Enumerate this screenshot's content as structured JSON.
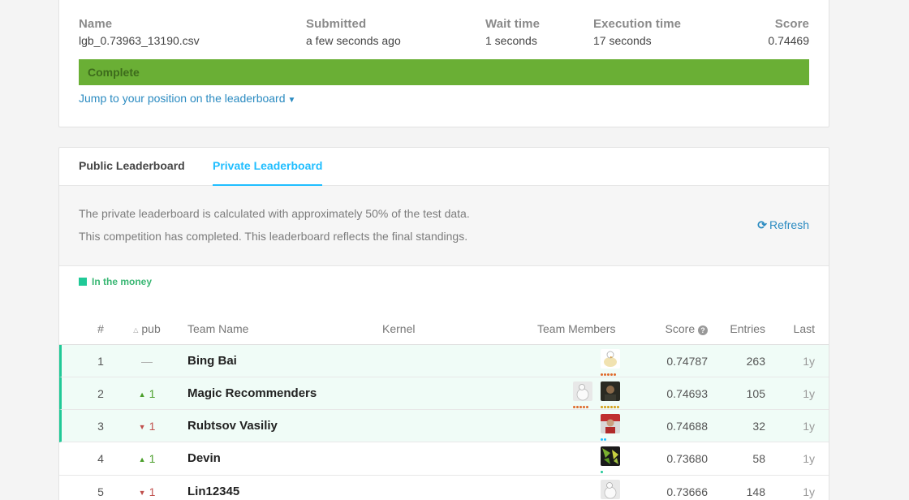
{
  "submission": {
    "name_label": "Name",
    "name_value": "lgb_0.73963_13190.csv",
    "submitted_label": "Submitted",
    "submitted_value": "a few seconds ago",
    "wait_label": "Wait time",
    "wait_value": "1 seconds",
    "exec_label": "Execution time",
    "exec_value": "17 seconds",
    "score_label": "Score",
    "score_value": "0.74469",
    "status": "Complete",
    "jump_link": "Jump to your position on the leaderboard"
  },
  "leaderboard": {
    "tabs": [
      {
        "label": "Public Leaderboard"
      },
      {
        "label": "Private Leaderboard"
      }
    ],
    "info_line1": "The private leaderboard is calculated with approximately 50% of the test data.",
    "info_line2": "This competition has completed. This leaderboard reflects the final standings.",
    "refresh_label": "Refresh",
    "money_legend": "In the money",
    "columns": {
      "rank": "#",
      "pub": "pub",
      "team": "Team Name",
      "kernel": "Kernel",
      "members": "Team Members",
      "score": "Score",
      "entries": "Entries",
      "last": "Last"
    },
    "rows": [
      {
        "rank": "1",
        "delta": "—",
        "team": "Bing Bai",
        "score": "0.74787",
        "entries": "263",
        "last": "1y"
      },
      {
        "rank": "2",
        "delta": "1",
        "team": "Magic Recommenders",
        "score": "0.74693",
        "entries": "105",
        "last": "1y"
      },
      {
        "rank": "3",
        "delta": "1",
        "team": "Rubtsov Vasiliy",
        "score": "0.74688",
        "entries": "32",
        "last": "1y"
      },
      {
        "rank": "4",
        "delta": "1",
        "team": "Devin",
        "score": "0.73680",
        "entries": "58",
        "last": "1y"
      },
      {
        "rank": "5",
        "delta": "1",
        "team": "Lin12345",
        "score": "0.73666",
        "entries": "148",
        "last": "1y"
      }
    ]
  },
  "colors": {
    "accent": "#20beff",
    "complete": "#6aaf35",
    "money": "#20c997",
    "up": "#4a9e2a",
    "down": "#c0504d"
  }
}
